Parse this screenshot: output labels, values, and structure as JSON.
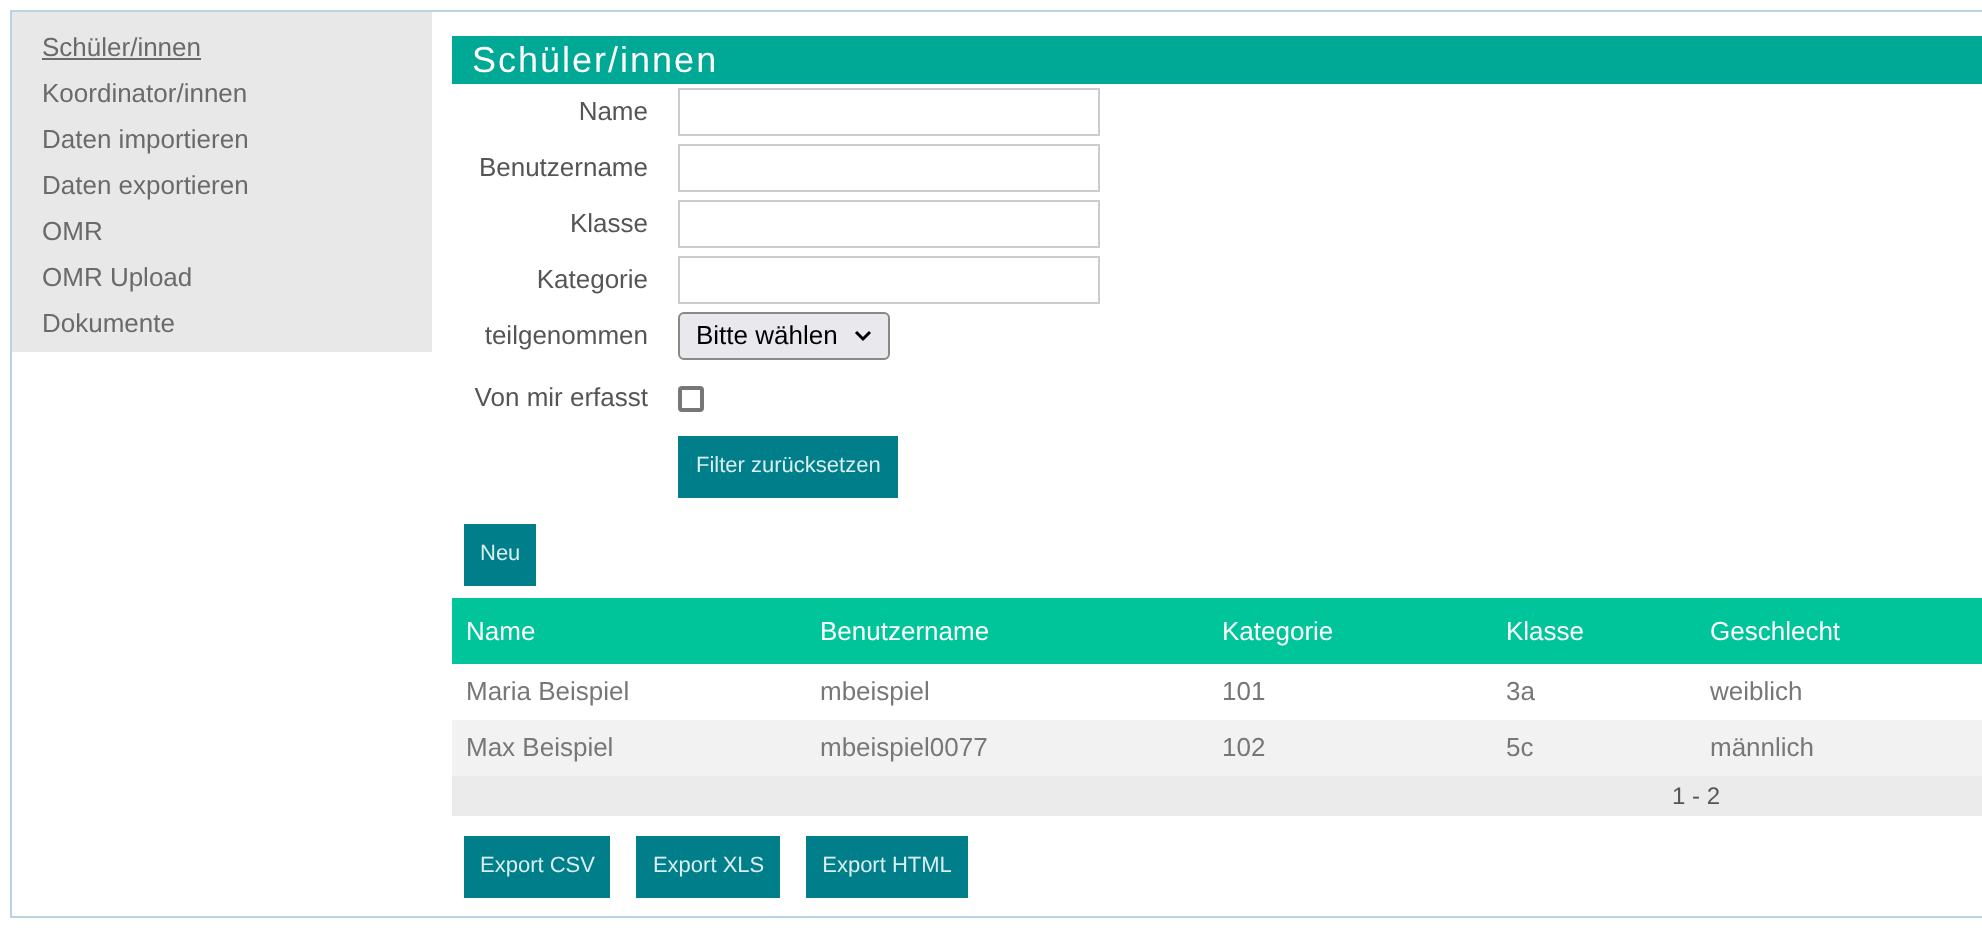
{
  "sidebar": {
    "items": [
      {
        "label": "Schüler/innen",
        "selected": true
      },
      {
        "label": "Koordinator/innen",
        "selected": false
      },
      {
        "label": "Daten importieren",
        "selected": false
      },
      {
        "label": "Daten exportieren",
        "selected": false
      },
      {
        "label": "OMR",
        "selected": false
      },
      {
        "label": "OMR Upload",
        "selected": false
      },
      {
        "label": "Dokumente",
        "selected": false
      }
    ]
  },
  "title": "Schüler/innen",
  "filters": [
    {
      "kind": "text",
      "label": "Name"
    },
    {
      "kind": "text",
      "label": "Benutzername"
    },
    {
      "kind": "text",
      "label": "Klasse"
    },
    {
      "kind": "text",
      "label": "Kategorie"
    },
    {
      "kind": "select",
      "label": "teilgenommen",
      "value": "Bitte wählen"
    },
    {
      "kind": "checkbox",
      "label": "Von mir erfasst",
      "checked": false
    }
  ],
  "reset_button": "Filter zurücksetzen",
  "new_button": "Neu",
  "table": {
    "columns": [
      "Name",
      "Benutzername",
      "Kategorie",
      "Klasse",
      "Geschlecht"
    ],
    "rows": [
      [
        "Maria Beispiel",
        "mbeispiel",
        "101",
        "3a",
        "weiblich"
      ],
      [
        "Max Beispiel",
        "mbeispiel0077",
        "102",
        "5c",
        "männlich"
      ]
    ],
    "pager": "1 - 2"
  },
  "export_buttons": [
    "Export CSV",
    "Export XLS",
    "Export HTML"
  ]
}
